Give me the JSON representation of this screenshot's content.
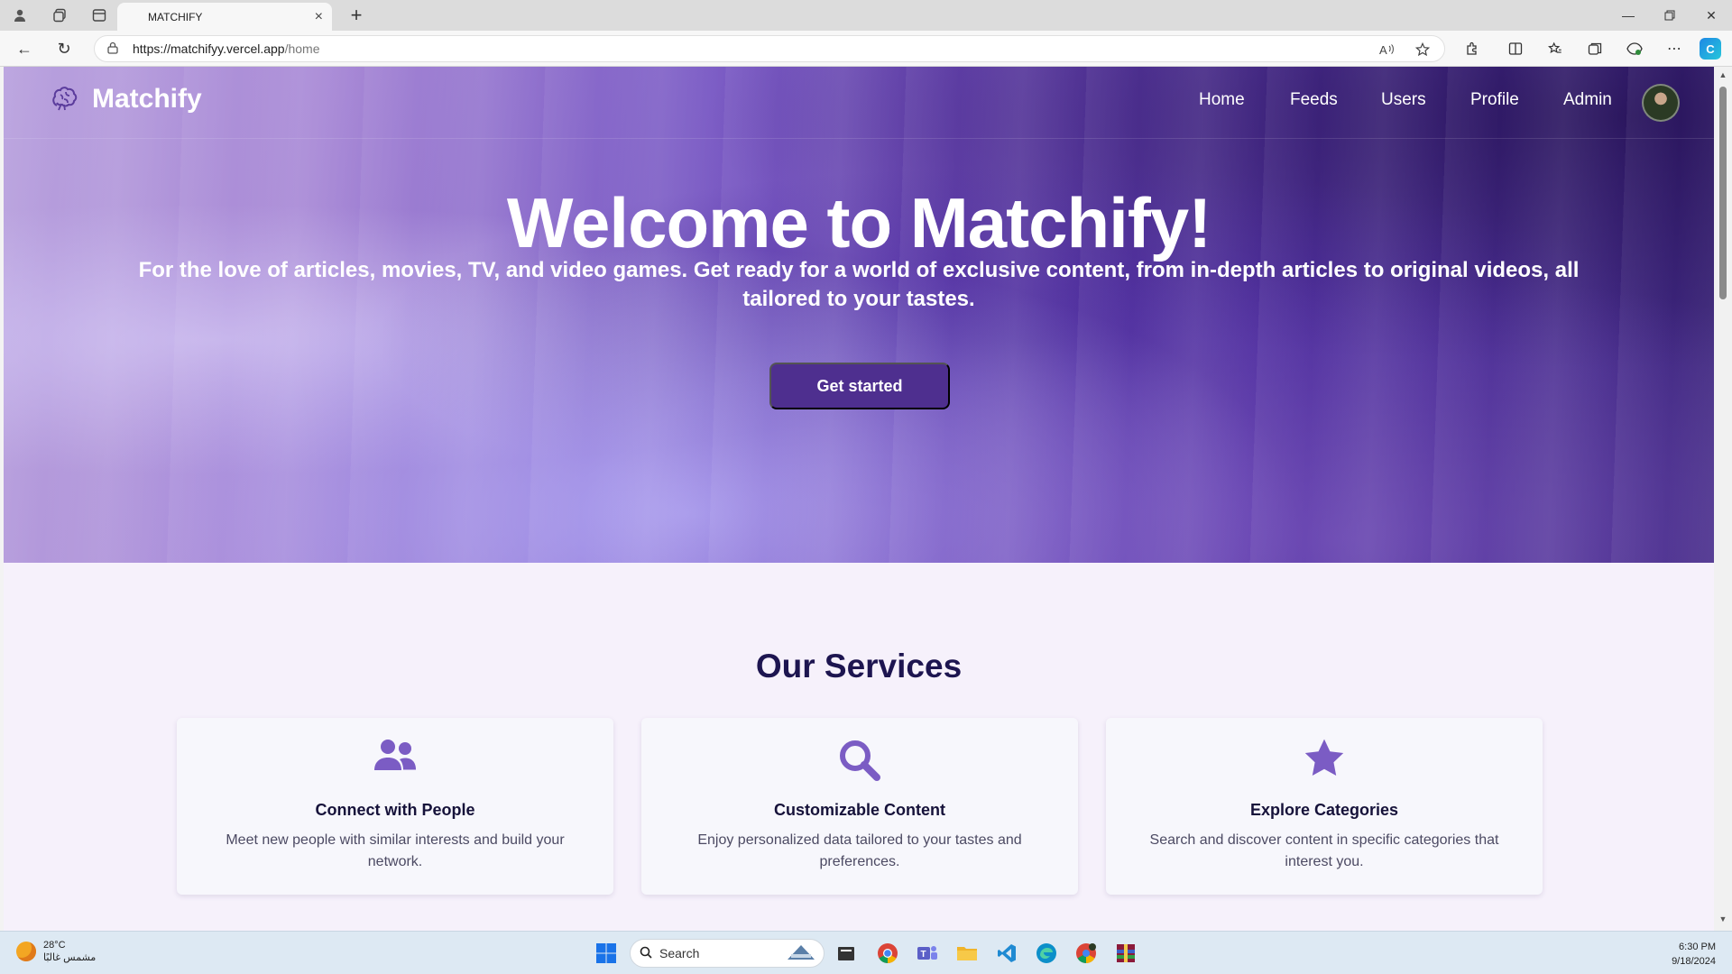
{
  "browser": {
    "tab_title": "MATCHIFY",
    "url_host": "https://matchifyy.vercel.app",
    "url_path": "/home",
    "read_aloud_label": "A⁾"
  },
  "site": {
    "brand": "Matchify",
    "nav": [
      {
        "label": "Home"
      },
      {
        "label": "Feeds"
      },
      {
        "label": "Users"
      },
      {
        "label": "Profile"
      },
      {
        "label": "Admin"
      }
    ],
    "hero": {
      "title": "Welcome to Matchify!",
      "subtitle": "For the love of articles, movies, TV, and video games. Get ready for a world of exclusive content, from in-depth articles to original videos, all tailored to your tastes.",
      "cta": "Get started"
    },
    "services": {
      "title": "Our Services",
      "cards": [
        {
          "icon": "users-icon",
          "title": "Connect with People",
          "text": "Meet new people with similar interests and build your network."
        },
        {
          "icon": "search-icon",
          "title": "Customizable Content",
          "text": "Enjoy personalized data tailored to your tastes and preferences."
        },
        {
          "icon": "star-icon",
          "title": "Explore Categories",
          "text": "Search and discover content in specific categories that interest you."
        }
      ]
    },
    "colors": {
      "accent": "#7b5cc4",
      "cta": "#4e2f8f",
      "heading": "#1d1550"
    }
  },
  "taskbar": {
    "weather_temp": "28°C",
    "weather_desc": "مشمس غالبًا",
    "search_placeholder": "Search",
    "time": "6:30 PM",
    "date": "9/18/2024"
  }
}
